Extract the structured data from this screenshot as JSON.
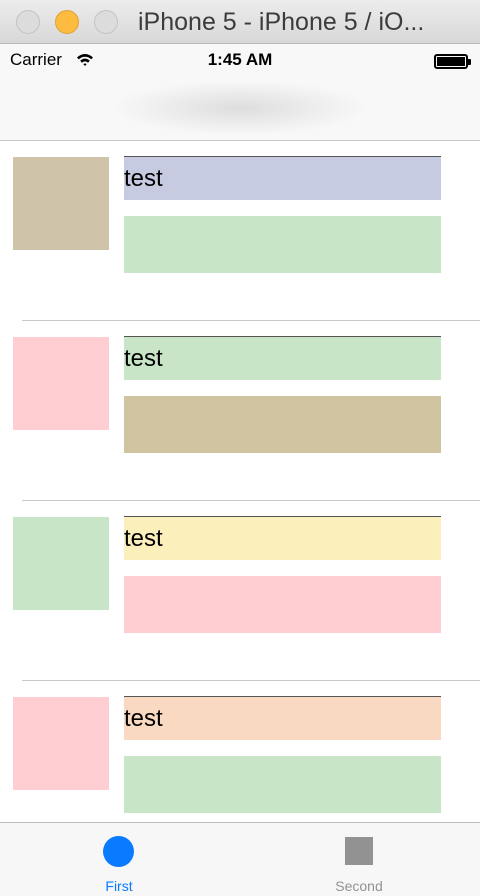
{
  "window": {
    "title": "iPhone 5 - iPhone 5 / iO..."
  },
  "statusbar": {
    "carrier": "Carrier",
    "time": "1:45 AM"
  },
  "cells": [
    {
      "label": "test",
      "thumb_color": "#cfc3aa",
      "label_color": "#c6cbe1",
      "box_color": "#c8e6c7"
    },
    {
      "label": "test",
      "thumb_color": "#ffced2",
      "label_color": "#c8e6c7",
      "box_color": "#cfc3a0"
    },
    {
      "label": "test",
      "thumb_color": "#c8e6c7",
      "label_color": "#fbefbb",
      "box_color": "#ffced2"
    },
    {
      "label": "test",
      "thumb_color": "#ffced2",
      "label_color": "#fad9c2",
      "box_color": "#c8e6c7"
    }
  ],
  "tabs": [
    {
      "label": "First",
      "color": "#0a7aff",
      "icon": "circle-icon",
      "selected": true
    },
    {
      "label": "Second",
      "color": "#929292",
      "icon": "square-icon",
      "selected": false
    }
  ]
}
